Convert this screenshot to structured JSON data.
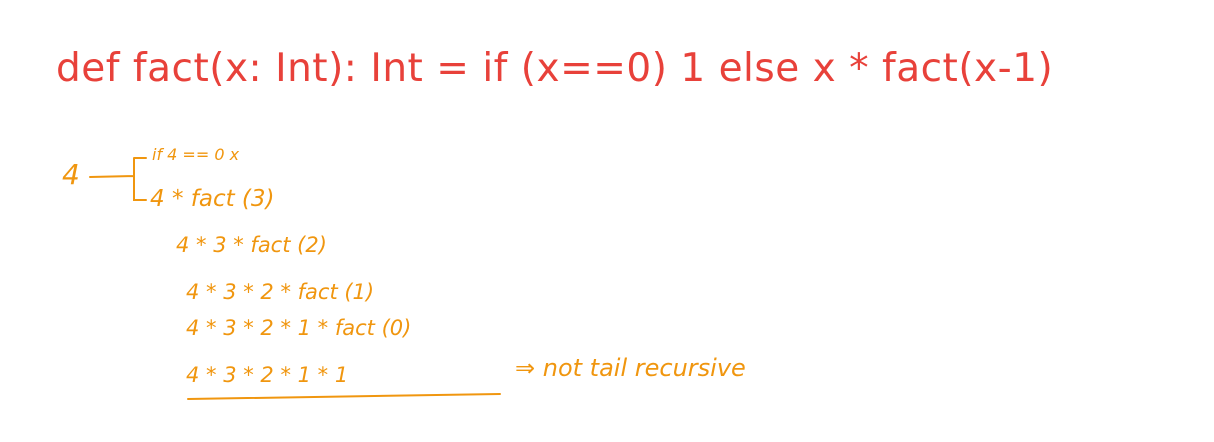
{
  "colors": {
    "heading": "#e8413a",
    "annotation": "#f0960f"
  },
  "heading": {
    "code": "def fact(x: Int): Int = if (x==0) 1 else x * fact(x-1)"
  },
  "trace": {
    "root": "4",
    "branch_condition": "if 4 == 0 x",
    "steps": [
      "4 * fact (3)",
      "4 * 3 * fact (2)",
      "4 * 3 * 2 * fact (1)",
      "4 * 3 * 2 * 1 * fact (0)",
      "4 * 3 * 2 * 1 * 1"
    ],
    "conclusion": "⇒ not tail recursive"
  }
}
